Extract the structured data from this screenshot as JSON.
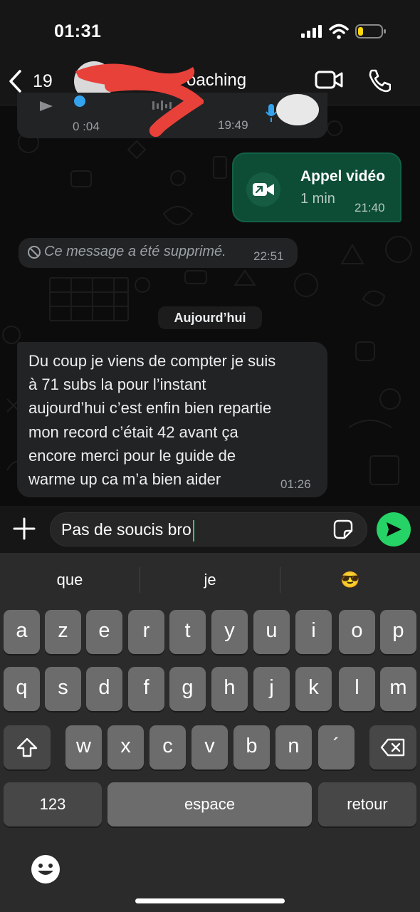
{
  "status_bar": {
    "time": "01:31"
  },
  "header": {
    "back_count": "19",
    "contact_name_visible": "oaching"
  },
  "messages": {
    "audio": {
      "duration": "0 :04",
      "time": "19:49"
    },
    "video_call": {
      "title": "Appel vidéo",
      "duration": "1 min",
      "time": "21:40"
    },
    "deleted": {
      "text": "Ce message a été supprimé.",
      "time": "22:51"
    },
    "date_separator": "Aujourd’hui",
    "incoming_text": {
      "lines": [
        "Du coup je viens de compter je suis",
        "à 71 subs la pour l’instant",
        "aujourd’hui c’est enfin bien repartie",
        "mon record c’était 42 avant ça",
        "encore merci pour le guide de",
        "warme up ca m’a bien aider"
      ],
      "time": "01:26"
    }
  },
  "composer": {
    "input_value": "Pas de soucis bro"
  },
  "keyboard": {
    "suggestions": [
      "que",
      "je",
      "😎"
    ],
    "row1": [
      "a",
      "z",
      "e",
      "r",
      "t",
      "y",
      "u",
      "i",
      "o",
      "p"
    ],
    "row2": [
      "q",
      "s",
      "d",
      "f",
      "g",
      "h",
      "j",
      "k",
      "l",
      "m"
    ],
    "row3": [
      "w",
      "x",
      "c",
      "v",
      "b",
      "n",
      "´"
    ],
    "numbers_label": "123",
    "space_label": "espace",
    "return_label": "retour"
  },
  "colors": {
    "accent_green": "#25d366",
    "outgoing_bubble": "#0d4d36",
    "incoming_bubble": "#222325",
    "key_light": "#6c6c6c",
    "key_dark": "#474747"
  }
}
